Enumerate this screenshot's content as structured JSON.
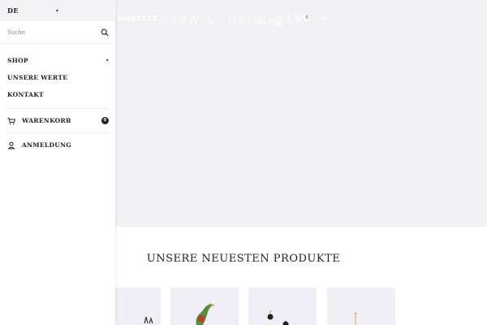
{
  "header": {
    "nav_kontakt": "KONTAKT",
    "logo": "DARWIN’ DAUGHTER",
    "cart_count": "0",
    "lang": "DE"
  },
  "drawer": {
    "language": "DE",
    "search_placeholder": "Suche",
    "menu": [
      {
        "label": "SHOP",
        "has_submenu": true
      },
      {
        "label": "UNSERE WERTE"
      },
      {
        "label": "KONTAKT"
      }
    ],
    "cart_label": "WARENKORB",
    "cart_count": "0",
    "login_label": "ANMELDUNG"
  },
  "main": {
    "section_title": "UNSERE NEUESTEN PRODUKTE"
  },
  "colors": {
    "hero_bg": "#f2f2f4",
    "drawer_bg": "#ffffff",
    "product_bg": "#f0eff6",
    "badge": "#222222"
  }
}
